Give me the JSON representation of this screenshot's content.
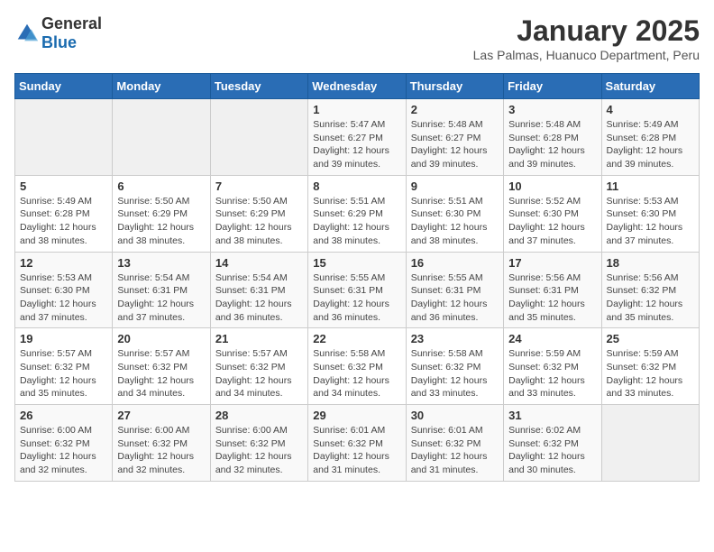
{
  "logo": {
    "general": "General",
    "blue": "Blue"
  },
  "header": {
    "month": "January 2025",
    "location": "Las Palmas, Huanuco Department, Peru"
  },
  "days_of_week": [
    "Sunday",
    "Monday",
    "Tuesday",
    "Wednesday",
    "Thursday",
    "Friday",
    "Saturday"
  ],
  "weeks": [
    [
      {
        "day": "",
        "sunrise": "",
        "sunset": "",
        "daylight": ""
      },
      {
        "day": "",
        "sunrise": "",
        "sunset": "",
        "daylight": ""
      },
      {
        "day": "",
        "sunrise": "",
        "sunset": "",
        "daylight": ""
      },
      {
        "day": "1",
        "sunrise": "Sunrise: 5:47 AM",
        "sunset": "Sunset: 6:27 PM",
        "daylight": "Daylight: 12 hours and 39 minutes."
      },
      {
        "day": "2",
        "sunrise": "Sunrise: 5:48 AM",
        "sunset": "Sunset: 6:27 PM",
        "daylight": "Daylight: 12 hours and 39 minutes."
      },
      {
        "day": "3",
        "sunrise": "Sunrise: 5:48 AM",
        "sunset": "Sunset: 6:28 PM",
        "daylight": "Daylight: 12 hours and 39 minutes."
      },
      {
        "day": "4",
        "sunrise": "Sunrise: 5:49 AM",
        "sunset": "Sunset: 6:28 PM",
        "daylight": "Daylight: 12 hours and 39 minutes."
      }
    ],
    [
      {
        "day": "5",
        "sunrise": "Sunrise: 5:49 AM",
        "sunset": "Sunset: 6:28 PM",
        "daylight": "Daylight: 12 hours and 38 minutes."
      },
      {
        "day": "6",
        "sunrise": "Sunrise: 5:50 AM",
        "sunset": "Sunset: 6:29 PM",
        "daylight": "Daylight: 12 hours and 38 minutes."
      },
      {
        "day": "7",
        "sunrise": "Sunrise: 5:50 AM",
        "sunset": "Sunset: 6:29 PM",
        "daylight": "Daylight: 12 hours and 38 minutes."
      },
      {
        "day": "8",
        "sunrise": "Sunrise: 5:51 AM",
        "sunset": "Sunset: 6:29 PM",
        "daylight": "Daylight: 12 hours and 38 minutes."
      },
      {
        "day": "9",
        "sunrise": "Sunrise: 5:51 AM",
        "sunset": "Sunset: 6:30 PM",
        "daylight": "Daylight: 12 hours and 38 minutes."
      },
      {
        "day": "10",
        "sunrise": "Sunrise: 5:52 AM",
        "sunset": "Sunset: 6:30 PM",
        "daylight": "Daylight: 12 hours and 37 minutes."
      },
      {
        "day": "11",
        "sunrise": "Sunrise: 5:53 AM",
        "sunset": "Sunset: 6:30 PM",
        "daylight": "Daylight: 12 hours and 37 minutes."
      }
    ],
    [
      {
        "day": "12",
        "sunrise": "Sunrise: 5:53 AM",
        "sunset": "Sunset: 6:30 PM",
        "daylight": "Daylight: 12 hours and 37 minutes."
      },
      {
        "day": "13",
        "sunrise": "Sunrise: 5:54 AM",
        "sunset": "Sunset: 6:31 PM",
        "daylight": "Daylight: 12 hours and 37 minutes."
      },
      {
        "day": "14",
        "sunrise": "Sunrise: 5:54 AM",
        "sunset": "Sunset: 6:31 PM",
        "daylight": "Daylight: 12 hours and 36 minutes."
      },
      {
        "day": "15",
        "sunrise": "Sunrise: 5:55 AM",
        "sunset": "Sunset: 6:31 PM",
        "daylight": "Daylight: 12 hours and 36 minutes."
      },
      {
        "day": "16",
        "sunrise": "Sunrise: 5:55 AM",
        "sunset": "Sunset: 6:31 PM",
        "daylight": "Daylight: 12 hours and 36 minutes."
      },
      {
        "day": "17",
        "sunrise": "Sunrise: 5:56 AM",
        "sunset": "Sunset: 6:31 PM",
        "daylight": "Daylight: 12 hours and 35 minutes."
      },
      {
        "day": "18",
        "sunrise": "Sunrise: 5:56 AM",
        "sunset": "Sunset: 6:32 PM",
        "daylight": "Daylight: 12 hours and 35 minutes."
      }
    ],
    [
      {
        "day": "19",
        "sunrise": "Sunrise: 5:57 AM",
        "sunset": "Sunset: 6:32 PM",
        "daylight": "Daylight: 12 hours and 35 minutes."
      },
      {
        "day": "20",
        "sunrise": "Sunrise: 5:57 AM",
        "sunset": "Sunset: 6:32 PM",
        "daylight": "Daylight: 12 hours and 34 minutes."
      },
      {
        "day": "21",
        "sunrise": "Sunrise: 5:57 AM",
        "sunset": "Sunset: 6:32 PM",
        "daylight": "Daylight: 12 hours and 34 minutes."
      },
      {
        "day": "22",
        "sunrise": "Sunrise: 5:58 AM",
        "sunset": "Sunset: 6:32 PM",
        "daylight": "Daylight: 12 hours and 34 minutes."
      },
      {
        "day": "23",
        "sunrise": "Sunrise: 5:58 AM",
        "sunset": "Sunset: 6:32 PM",
        "daylight": "Daylight: 12 hours and 33 minutes."
      },
      {
        "day": "24",
        "sunrise": "Sunrise: 5:59 AM",
        "sunset": "Sunset: 6:32 PM",
        "daylight": "Daylight: 12 hours and 33 minutes."
      },
      {
        "day": "25",
        "sunrise": "Sunrise: 5:59 AM",
        "sunset": "Sunset: 6:32 PM",
        "daylight": "Daylight: 12 hours and 33 minutes."
      }
    ],
    [
      {
        "day": "26",
        "sunrise": "Sunrise: 6:00 AM",
        "sunset": "Sunset: 6:32 PM",
        "daylight": "Daylight: 12 hours and 32 minutes."
      },
      {
        "day": "27",
        "sunrise": "Sunrise: 6:00 AM",
        "sunset": "Sunset: 6:32 PM",
        "daylight": "Daylight: 12 hours and 32 minutes."
      },
      {
        "day": "28",
        "sunrise": "Sunrise: 6:00 AM",
        "sunset": "Sunset: 6:32 PM",
        "daylight": "Daylight: 12 hours and 32 minutes."
      },
      {
        "day": "29",
        "sunrise": "Sunrise: 6:01 AM",
        "sunset": "Sunset: 6:32 PM",
        "daylight": "Daylight: 12 hours and 31 minutes."
      },
      {
        "day": "30",
        "sunrise": "Sunrise: 6:01 AM",
        "sunset": "Sunset: 6:32 PM",
        "daylight": "Daylight: 12 hours and 31 minutes."
      },
      {
        "day": "31",
        "sunrise": "Sunrise: 6:02 AM",
        "sunset": "Sunset: 6:32 PM",
        "daylight": "Daylight: 12 hours and 30 minutes."
      },
      {
        "day": "",
        "sunrise": "",
        "sunset": "",
        "daylight": ""
      }
    ]
  ]
}
